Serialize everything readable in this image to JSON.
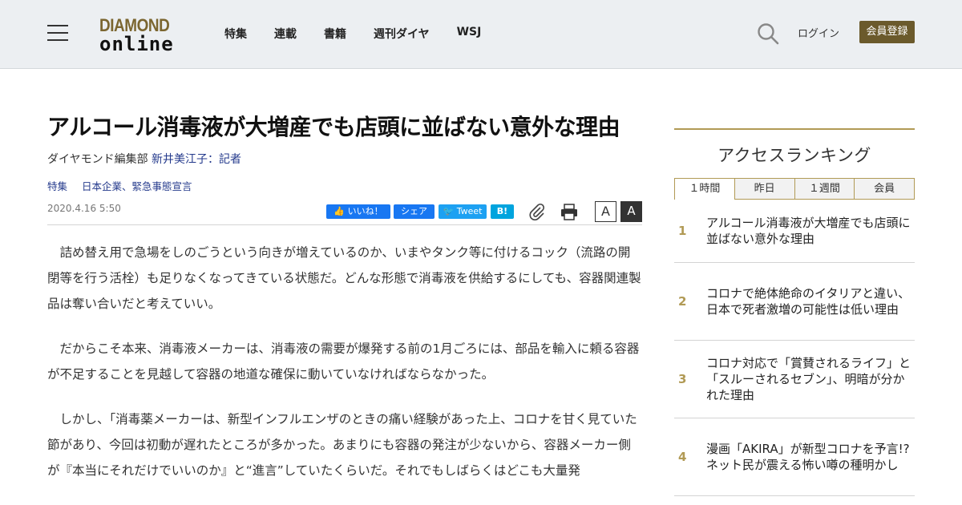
{
  "header": {
    "logo_top": "DIAMOND",
    "logo_bottom": "online",
    "nav": [
      "特集",
      "連載",
      "書籍",
      "週刊ダイヤ",
      "WSJ"
    ],
    "login": "ログイン",
    "register": "会員登録"
  },
  "article": {
    "title": "アルコール消毒液が大増産でも店頭に並ばない意外な理由",
    "byline_dept": "ダイヤモンド編集部",
    "byline_author": "新井美江子：記者",
    "tags": [
      "特集",
      "日本企業、緊急事態宣言"
    ],
    "date": "2020.4.16 5:50",
    "share": {
      "fb_like": "いいね！",
      "fb_share": "シェア",
      "tweet": "Tweet",
      "hatena": "B!"
    },
    "font_small": "A",
    "font_large": "A",
    "paragraphs": [
      "詰め替え用で急場をしのごうという向きが増えているのか、いまやタンク等に付けるコック（流路の開閉等を行う活栓）も足りなくなってきている状態だ。どんな形態で消毒液を供給するにしても、容器関連製品は奪い合いだと考えていい。",
      "だからこそ本来、消毒液メーカーは、消毒液の需要が爆発する前の1月ごろには、部品を輸入に頼る容器が不足することを見越して容器の地道な確保に動いていなければならなかった。",
      "しかし、「消毒薬メーカーは、新型インフルエンザのときの痛い経験があった上、コロナを甘く見ていた節があり、今回は初動が遅れたところが多かった。あまりにも容器の発注が少ないから、容器メーカー側が『本当にそれだけでいいのか』と“進言”していたくらいだ。それでもしばらくはどこも大量発"
    ]
  },
  "sidebar": {
    "title": "アクセスランキング",
    "tabs": [
      "１時間",
      "昨日",
      "１週間",
      "会員"
    ],
    "ranking": [
      {
        "num": "1",
        "text": "アルコール消毒液が大増産でも店頭に並ばない意外な理由"
      },
      {
        "num": "2",
        "text": "コロナで絶体絶命のイタリアと違い、日本で死者激増の可能性は低い理由"
      },
      {
        "num": "3",
        "text": "コロナ対応で「賞賛されるライフ」と「スルーされるセブン」、明暗が分かれた理由"
      },
      {
        "num": "4",
        "text": "漫画「AKIRA」が新型コロナを予言!?ネット民が震える怖い噂の種明かし"
      }
    ]
  }
}
